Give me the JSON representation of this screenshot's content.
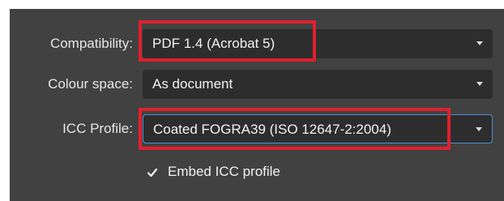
{
  "fields": [
    {
      "label": "Compatibility:",
      "value": "PDF 1.4 (Acrobat 5)"
    },
    {
      "label": "Colour space:",
      "value": "As document"
    },
    {
      "label": "ICC Profile:",
      "value": "Coated FOGRA39 (ISO 12647-2:2004)"
    }
  ],
  "embed_icc": {
    "label": "Embed ICC profile",
    "checked": true,
    "icon": "checkmark-icon"
  },
  "colors": {
    "panel_bg": "#414141",
    "dropdown_bg": "#2d2d2d",
    "focus_border": "#4d8fd1",
    "highlight": "#e0202f"
  }
}
